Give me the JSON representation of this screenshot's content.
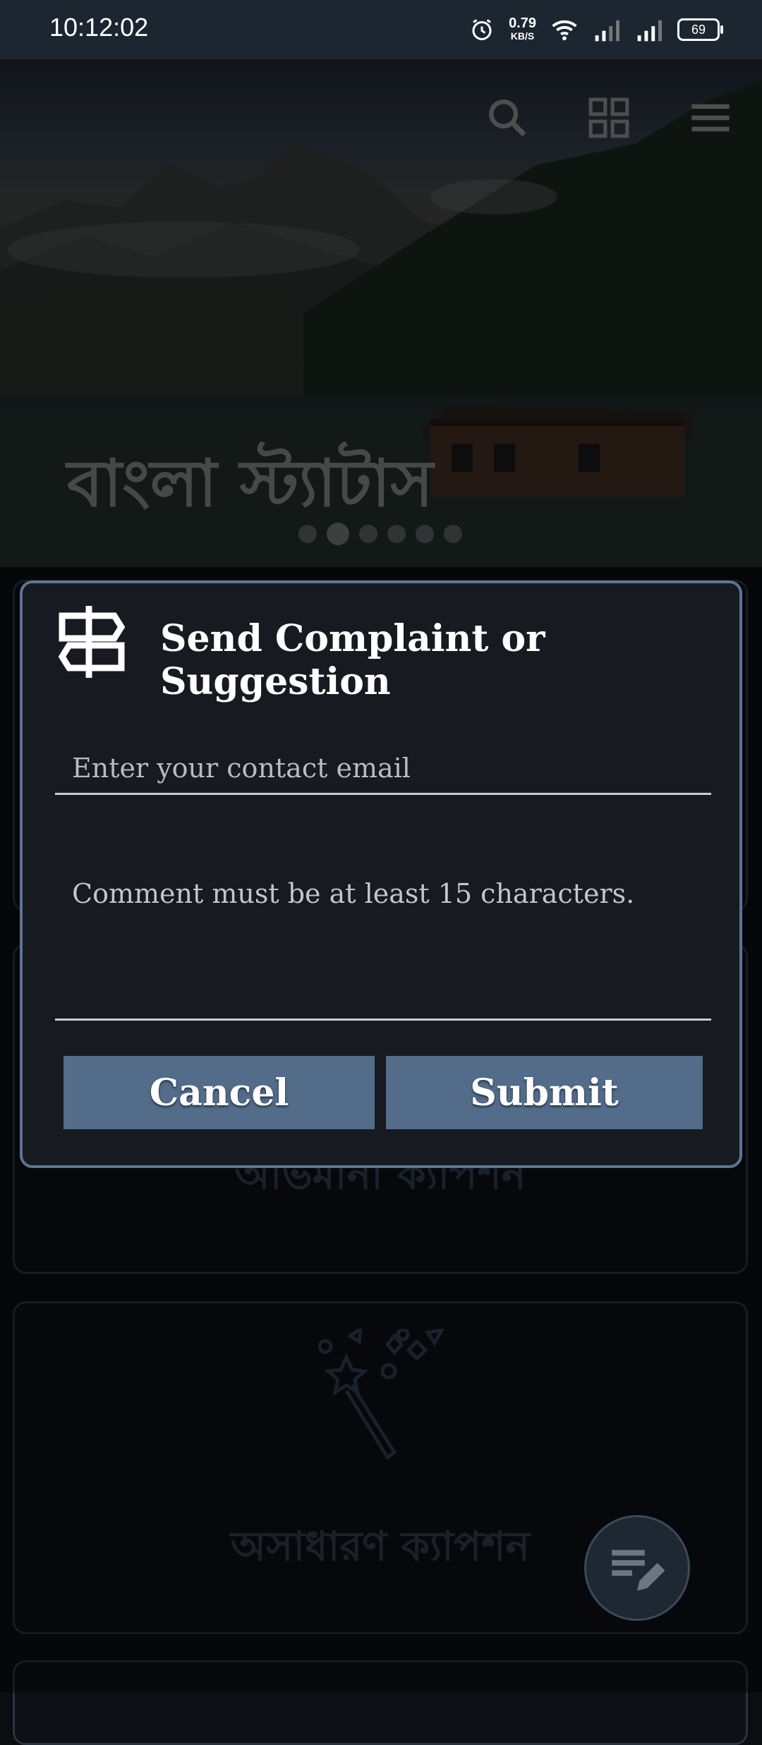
{
  "status_bar": {
    "time": "10:12:02",
    "net_speed_value": "0.79",
    "net_speed_unit": "KB/S",
    "battery": "69",
    "icons": [
      "alarm-icon",
      "wifi-icon",
      "signal-icon",
      "signal-icon"
    ]
  },
  "hero": {
    "title": "বাংলা স্ট্যাটাস",
    "slide_count": 6,
    "active_slide": 2,
    "actions": [
      "search-icon",
      "grid-icon",
      "menu-icon"
    ]
  },
  "cards": [
    {
      "label": "অভিমানী ক্যাপশন"
    },
    {
      "label": "অসাধারণ ক্যাপশন",
      "icon": "magic-wand-icon"
    }
  ],
  "dialog": {
    "title": "Send Complaint or Suggestion",
    "icon": "signpost-icon",
    "email_placeholder": "Enter your contact email",
    "comment_placeholder": "Comment must be at least 15 characters.",
    "cancel_label": "Cancel",
    "submit_label": "Submit"
  },
  "fab": {
    "icon": "edit-note-icon"
  },
  "colors": {
    "accent": "#526c8a",
    "dialog_border": "#5e7590",
    "dialog_bg": "#171a20",
    "status_bar": "#1c2630"
  }
}
